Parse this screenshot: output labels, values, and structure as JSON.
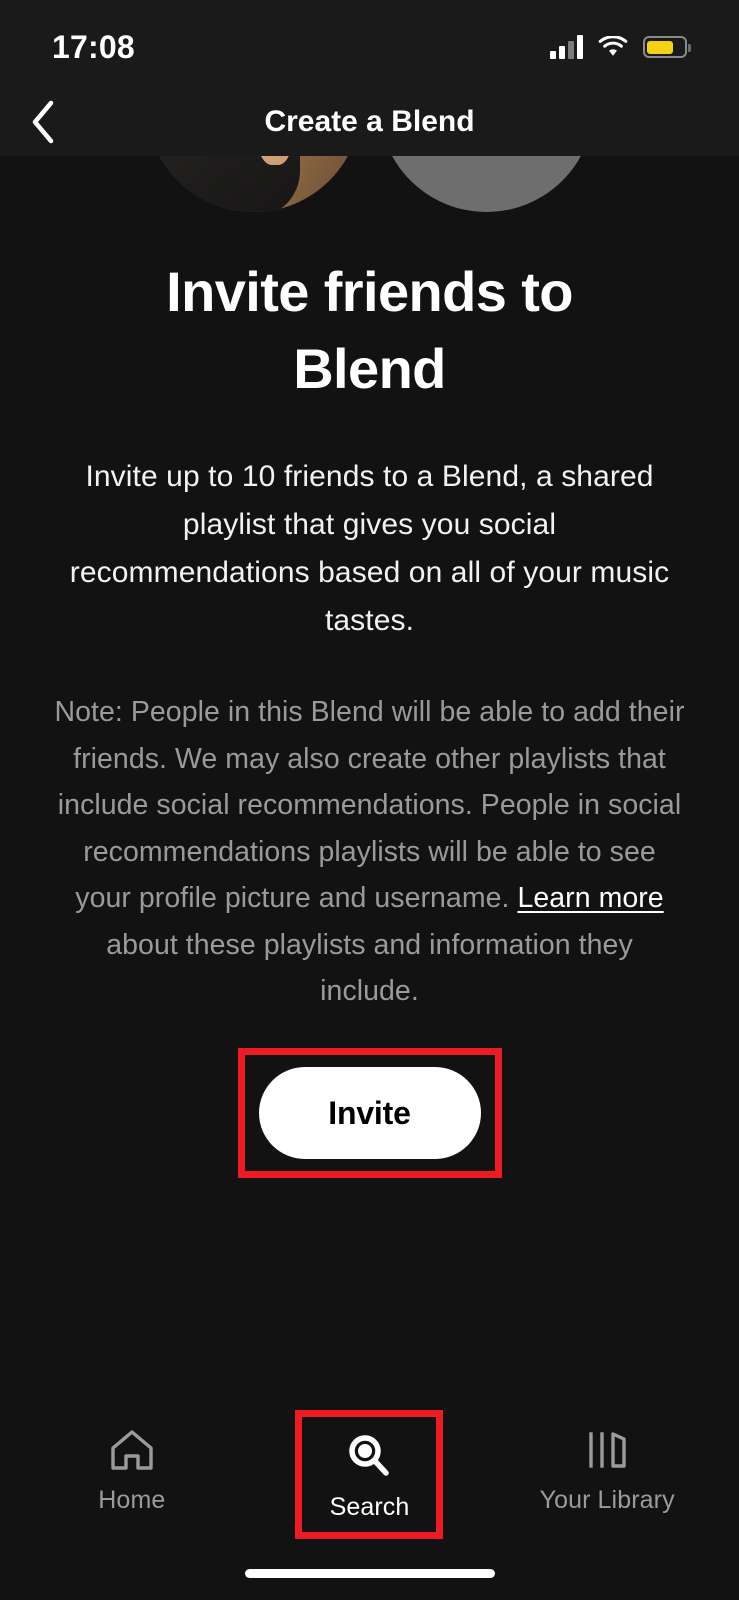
{
  "status_bar": {
    "time": "17:08",
    "cellular_icon": "cellular-signal-icon",
    "wifi_icon": "wifi-icon",
    "battery_icon": "battery-icon",
    "battery_level_percent": 65,
    "battery_color": "#f5d216"
  },
  "header": {
    "back_icon": "chevron-left-icon",
    "title": "Create a Blend"
  },
  "avatars": [
    {
      "name": "friend-avatar-photo",
      "type": "photo"
    },
    {
      "name": "friend-avatar-placeholder",
      "type": "placeholder",
      "color": "#6e6e6e"
    }
  ],
  "main": {
    "headline": "Invite friends to Blend",
    "description": "Invite up to 10 friends to a Blend, a shared playlist that gives you social recommendations based on all of your music tastes.",
    "note_part1": "Note: People in this Blend will be able to add their friends. We may also create other playlists that include social recommendations. People in social recommendations playlists will be able to see your profile picture and username. ",
    "note_link": "Learn more",
    "note_part2": " about these playlists and information they include.",
    "invite_button_label": "Invite"
  },
  "highlight": {
    "color": "#ed1c24",
    "targets": [
      "invite-button",
      "search-tab"
    ]
  },
  "tabbar": {
    "tabs": [
      {
        "label": "Home",
        "icon": "home-icon",
        "active": false,
        "highlighted": false
      },
      {
        "label": "Search",
        "icon": "search-icon",
        "active": true,
        "highlighted": true
      },
      {
        "label": "Your Library",
        "icon": "library-icon",
        "active": false,
        "highlighted": false
      }
    ]
  }
}
